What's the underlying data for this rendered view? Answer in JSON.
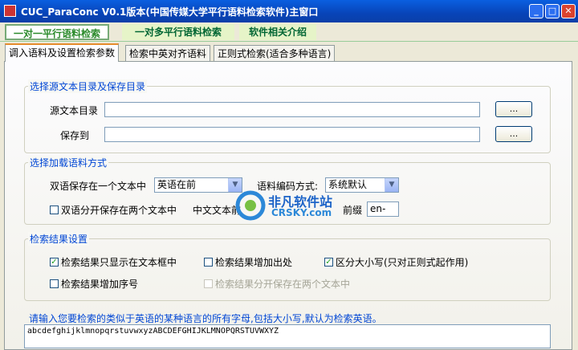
{
  "window": {
    "title": "CUC_ParaConc V0.1版本(中国传媒大学平行语料检索软件)主窗口",
    "min": "_",
    "max": "□",
    "close": "✕"
  },
  "top_tabs": [
    "一对一平行语料检索",
    "一对多平行语料检索",
    "软件相关介绍"
  ],
  "sub_tabs": [
    "调入语料及设置检索参数",
    "检索中英对齐语料",
    "正则式检索(适合多种语言)"
  ],
  "group1": {
    "title": "选择源文本目录及保存目录",
    "source_label": "源文本目录",
    "source_value": "",
    "save_label": "保存到",
    "save_value": "",
    "browse": "..."
  },
  "group2": {
    "title": "选择加载语料方式",
    "bilingual_label": "双语保存在一个文本中",
    "order_value": "英语在前",
    "encoding_label": "语料编码方式:",
    "encoding_value": "系统默认",
    "separate_label": "双语分开保存在两个文本中",
    "chinese_label": "中文文本前",
    "prefix_label": "前缀",
    "prefix_value": "en-"
  },
  "group3": {
    "title": "检索结果设置",
    "opt1": "检索结果只显示在文本框中",
    "opt2": "检索结果增加出处",
    "opt3": "区分大小写(只对正则式起作用)",
    "opt4": "检索结果增加序号",
    "opt5": "检索结果分开保存在两个文本中"
  },
  "alphabet": {
    "prompt": "请输入您要检索的类似于英语的某种语言的所有字母,包括大小写,默认为检索英语。",
    "value": "abcdefghijklmnopqrstuvwxyzABCDEFGHIJKLMNOPQRSTUVWXYZ"
  },
  "watermark": {
    "main": "非凡软件站",
    "sub": "CRSKY.com"
  }
}
